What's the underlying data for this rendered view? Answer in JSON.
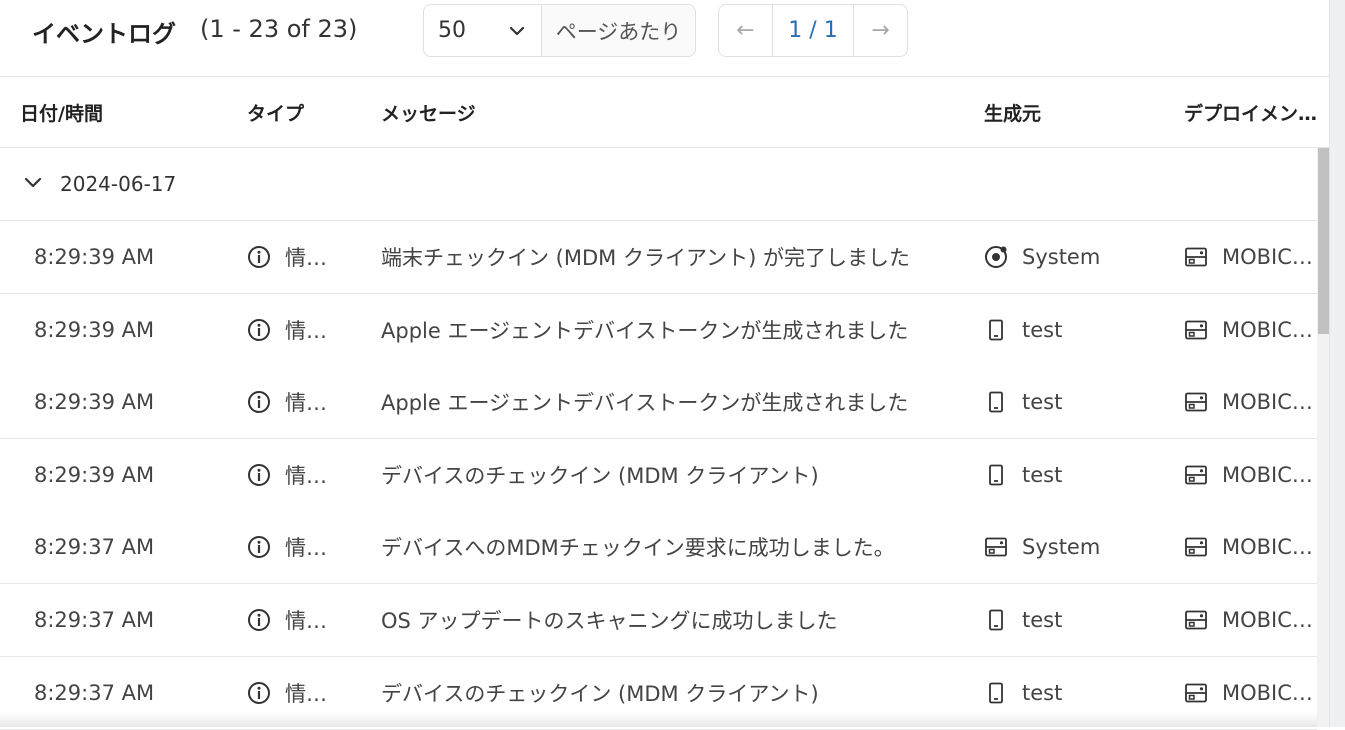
{
  "header": {
    "title": "イベントログ",
    "count": "(1 - 23 of 23)",
    "per_page_value": "50",
    "per_page_label": "ページあたり",
    "page_indicator": "1 / 1",
    "prev_glyph": "←",
    "next_glyph": "→"
  },
  "columns": [
    "日付/時間",
    "タイプ",
    "メッセージ",
    "生成元",
    "デプロイメン…"
  ],
  "group": {
    "date": "2024-06-17",
    "expanded": true,
    "icon": "chevron-down-icon"
  },
  "rows": [
    {
      "time": "8:29:39 AM",
      "type": "情…",
      "type_icon": "info-icon",
      "message": "端末チェックイン (MDM クライアント) が完了しました",
      "source": "System",
      "source_icon": "system-icon",
      "deployment": "MOBIC…",
      "deployment_icon": "server-icon"
    },
    {
      "time": "8:29:39 AM",
      "type": "情…",
      "type_icon": "info-icon",
      "message": "Apple エージェントデバイストークンが生成されました",
      "source": "test",
      "source_icon": "device-icon",
      "deployment": "MOBIC…",
      "deployment_icon": "server-icon"
    },
    {
      "time": "8:29:39 AM",
      "type": "情…",
      "type_icon": "info-icon",
      "message": "Apple エージェントデバイストークンが生成されました",
      "source": "test",
      "source_icon": "device-icon",
      "deployment": "MOBIC…",
      "deployment_icon": "server-icon"
    },
    {
      "time": "8:29:39 AM",
      "type": "情…",
      "type_icon": "info-icon",
      "message": "デバイスのチェックイン (MDM クライアント)",
      "source": "test",
      "source_icon": "device-icon",
      "deployment": "MOBIC…",
      "deployment_icon": "server-icon"
    },
    {
      "time": "8:29:37 AM",
      "type": "情…",
      "type_icon": "info-icon",
      "message": "デバイスへのMDMチェックイン要求に成功しました。",
      "source": "System",
      "source_icon": "server-icon",
      "deployment": "MOBIC…",
      "deployment_icon": "server-icon"
    },
    {
      "time": "8:29:37 AM",
      "type": "情…",
      "type_icon": "info-icon",
      "message": "OS アップデートのスキャニングに成功しました",
      "source": "test",
      "source_icon": "device-icon",
      "deployment": "MOBIC…",
      "deployment_icon": "server-icon"
    },
    {
      "time": "8:29:37 AM",
      "type": "情…",
      "type_icon": "info-icon",
      "message": "デバイスのチェックイン (MDM クライアント)",
      "source": "test",
      "source_icon": "device-icon",
      "deployment": "MOBIC…",
      "deployment_icon": "server-icon"
    }
  ],
  "colors": {
    "accent": "#2a6db5",
    "border": "#e6e6e6",
    "scroll_thumb": "#c1c1c1"
  }
}
